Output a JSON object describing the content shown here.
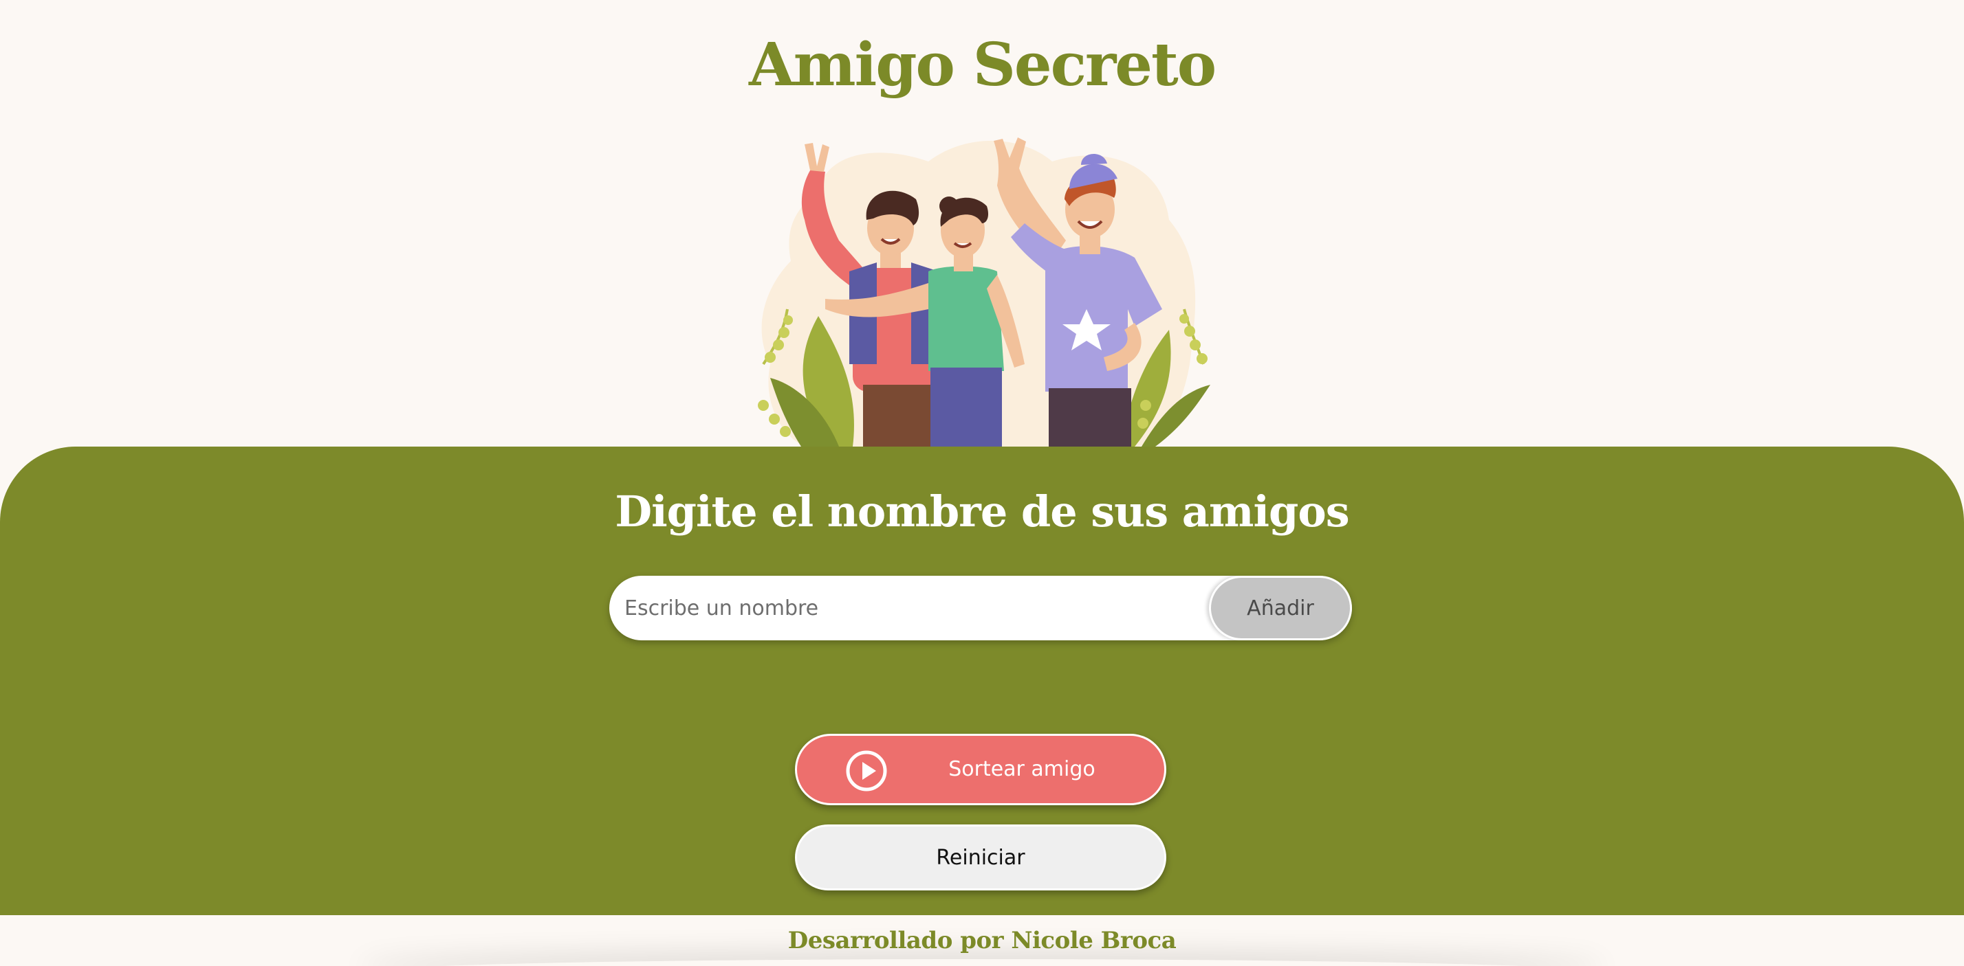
{
  "header": {
    "title": "Amigo Secreto"
  },
  "main": {
    "section_title": "Digite el nombre de sus amigos",
    "name_input": {
      "placeholder": "Escribe un nombre",
      "value": ""
    },
    "add_button_label": "Añadir",
    "draw_button_label": "Sortear amigo",
    "reset_button_label": "Reiniciar"
  },
  "footer": {
    "credits": "Desarrollado por Nicole Broca"
  },
  "icons": {
    "draw_button_icon": "play-circle-icon",
    "illustration": "friends-group-illustration"
  },
  "colors": {
    "brand_green": "#7d8a2a",
    "title_green": "#7c8a28",
    "background": "#fcf8f4",
    "draw_button": "#ed6f6d",
    "add_button": "#c4c4c4",
    "reset_button": "#efefef"
  }
}
